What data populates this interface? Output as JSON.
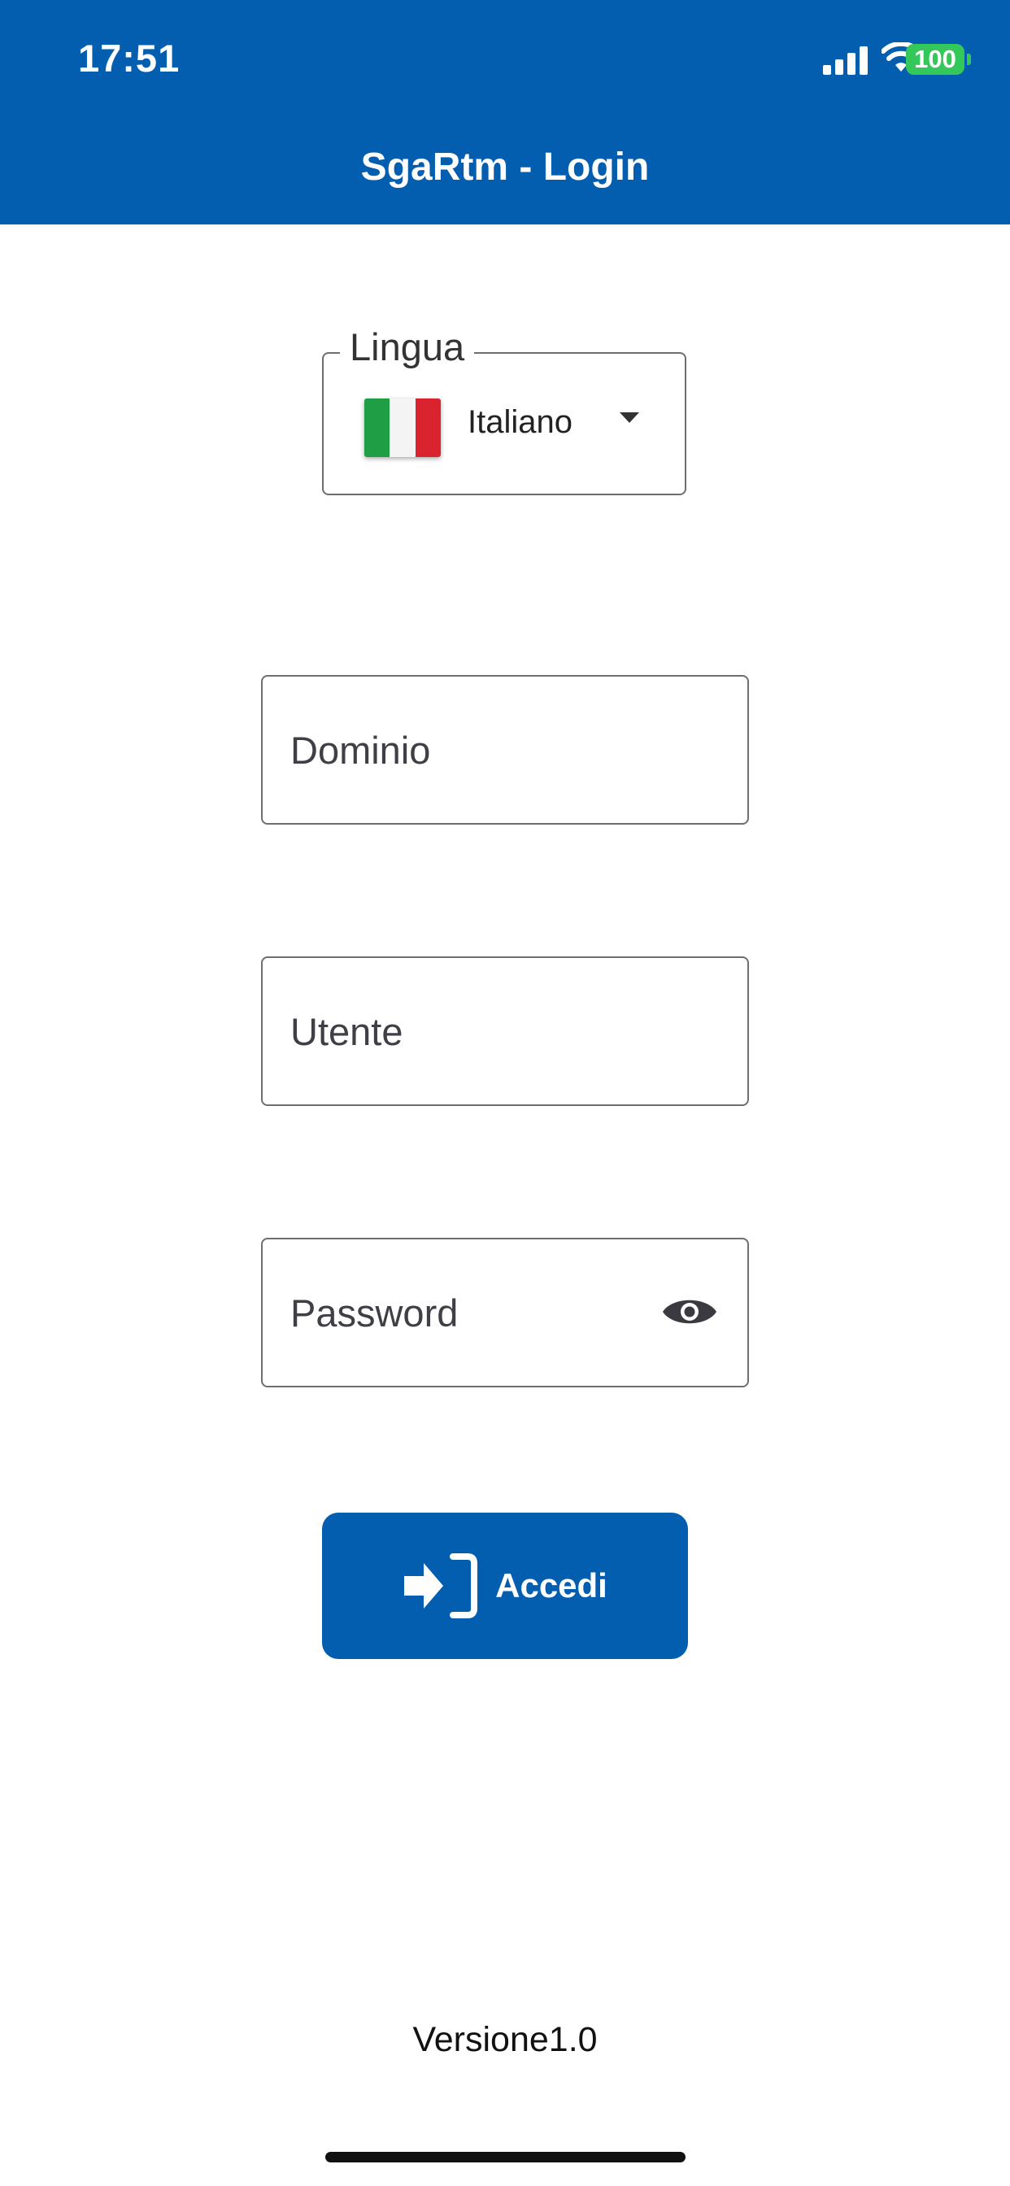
{
  "status_bar": {
    "time": "17:51",
    "battery": "100",
    "battery_color": "#34c759"
  },
  "header": {
    "title": "SgaRtm - Login",
    "color": "#035eb0"
  },
  "language_selector": {
    "legend": "Lingua",
    "selected": "Italiano",
    "flag_icon": "italy-flag-icon",
    "dropdown_icon": "caret-down-icon"
  },
  "form": {
    "domain_placeholder": "Dominio",
    "user_placeholder": "Utente",
    "password_placeholder": "Password",
    "password_toggle_icon": "eye-icon"
  },
  "login_button": {
    "label": "Accedi",
    "icon": "sign-in-icon"
  },
  "footer": {
    "version": "Versione1.0"
  }
}
